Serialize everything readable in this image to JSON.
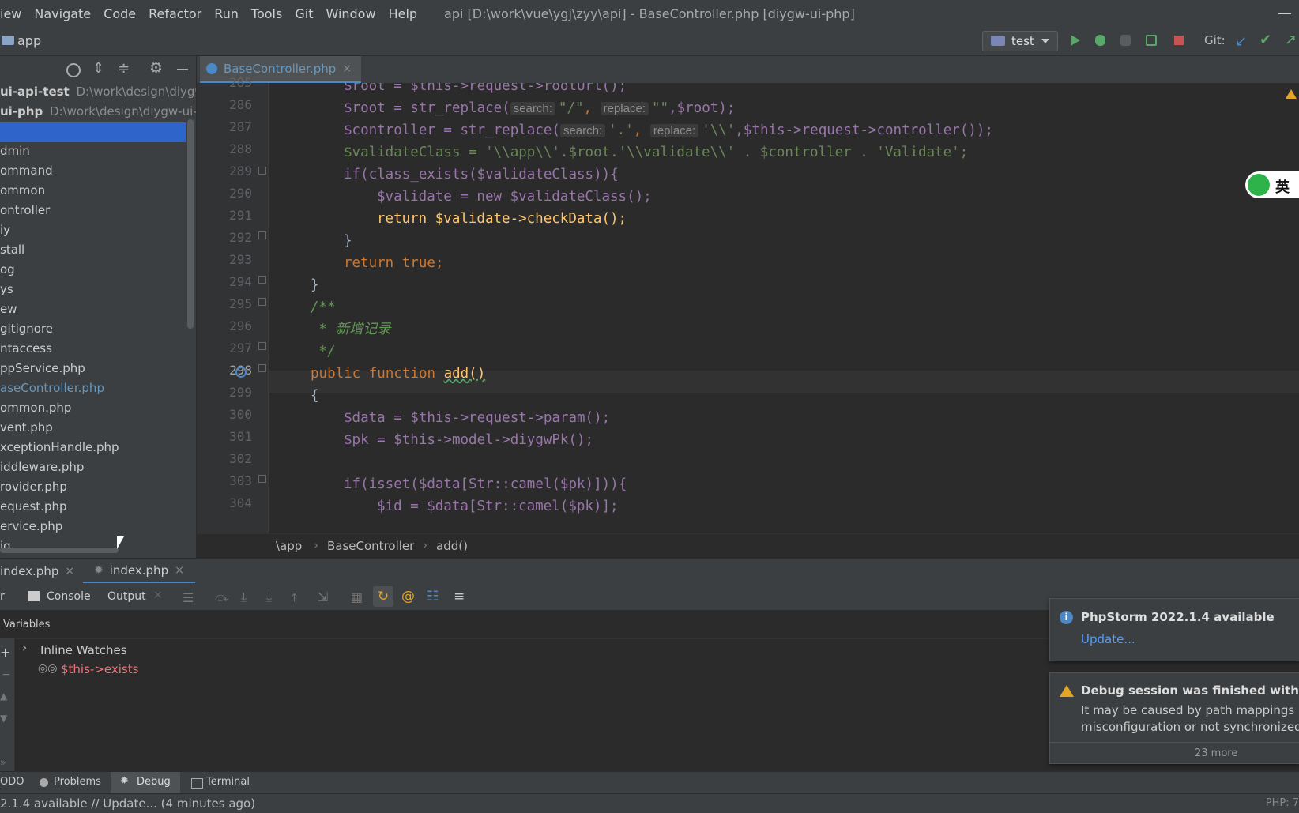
{
  "menu": [
    "iew",
    "Navigate",
    "Code",
    "Refactor",
    "Run",
    "Tools",
    "Git",
    "Window",
    "Help"
  ],
  "window_title": "api [D:\\work\\vue\\ygj\\zyy\\api] - BaseController.php [diygw-ui-php]",
  "navbar": {
    "crumb": "app",
    "run_config": "test",
    "git_label": "Git:"
  },
  "project_tree": [
    {
      "name": "ui-api-test",
      "path": "D:\\work\\design\\diygw-",
      "bold": true
    },
    {
      "name": "ui-php",
      "path": "D:\\work\\design\\diygw-ui-p",
      "bold": true
    },
    {
      "name": "",
      "path": "",
      "selected": true
    },
    {
      "name": "dmin"
    },
    {
      "name": "ommand"
    },
    {
      "name": "ommon"
    },
    {
      "name": "ontroller"
    },
    {
      "name": "iy"
    },
    {
      "name": "stall"
    },
    {
      "name": "og"
    },
    {
      "name": "ys"
    },
    {
      "name": "ew"
    },
    {
      "name": "gitignore"
    },
    {
      "name": "ntaccess"
    },
    {
      "name": "ppService.php"
    },
    {
      "name": "aseController.php",
      "active": true
    },
    {
      "name": "ommon.php"
    },
    {
      "name": "vent.php"
    },
    {
      "name": "xceptionHandle.php"
    },
    {
      "name": "iddleware.php"
    },
    {
      "name": "rovider.php"
    },
    {
      "name": "equest.php"
    },
    {
      "name": "ervice.php"
    },
    {
      "name": "ig"
    }
  ],
  "editor_tab": "BaseController.php",
  "line_numbers": [
    "285",
    "286",
    "287",
    "288",
    "289",
    "290",
    "291",
    "292",
    "293",
    "294",
    "295",
    "296",
    "297",
    "298",
    "299",
    "300",
    "301",
    "302",
    "303",
    "304"
  ],
  "code": {
    "l285": "$root = $this->request->rootUrl();",
    "l286a": "$root = str_replace(",
    "hint_search": "search:",
    "l286s1": "\"/\"",
    "hint_replace": "replace:",
    "l286s2": "\"\"",
    "l286b": ",$root);",
    "l287a": "$controller = str_replace(",
    "l287s1": "'.'",
    "l287s2": "'\\\\'",
    "l287b": ",$this->request->controller());",
    "l288": "$validateClass = '\\\\app\\\\'.$root.'\\\\validate\\\\' . $controller . 'Validate';",
    "l289": "if(class_exists($validateClass)){",
    "l290": "$validate = new $validateClass();",
    "l291": "return $validate->checkData();",
    "l292": "}",
    "l293": "return true;",
    "l294": "}",
    "l295": "/**",
    "l296": " * 新增记录",
    "l297": " */",
    "l298_kw": "public function ",
    "l298_fn": "add()",
    "l299": "{",
    "l300": "$data = $this->request->param();",
    "l301": "$pk = $this->model->diygwPk();",
    "l303": "if(isset($data[Str::camel($pk)])){",
    "l304": "$id = $data[Str::camel($pk)];"
  },
  "ime_badge": "英",
  "breadcrumb": [
    "\\app",
    "BaseController",
    "add()"
  ],
  "debug_tabs": [
    "index.php",
    "index.php"
  ],
  "debug_toolbar": {
    "console": "Console",
    "output": "Output",
    "left_cut": "r"
  },
  "variables_label": "Variables",
  "watches": {
    "group": "Inline Watches",
    "item": "$this->exists"
  },
  "notifications": [
    {
      "title": "PhpStorm 2022.1.4 available",
      "link": "Update..."
    },
    {
      "title": "Debug session was finished without b",
      "body1": "It may be caused by path mappings",
      "body2": "misconfiguration or not synchronized",
      "more": "23 more"
    }
  ],
  "bottom_tabs": [
    "ODO",
    "Problems",
    "Debug",
    "Terminal"
  ],
  "status": {
    "left": "2.1.4 available // Update... (4 minutes ago)",
    "right": "PHP: 7"
  },
  "colors": {
    "accent": "#4a88c7",
    "selection": "#2f65ca",
    "warning": "#e5a524"
  }
}
